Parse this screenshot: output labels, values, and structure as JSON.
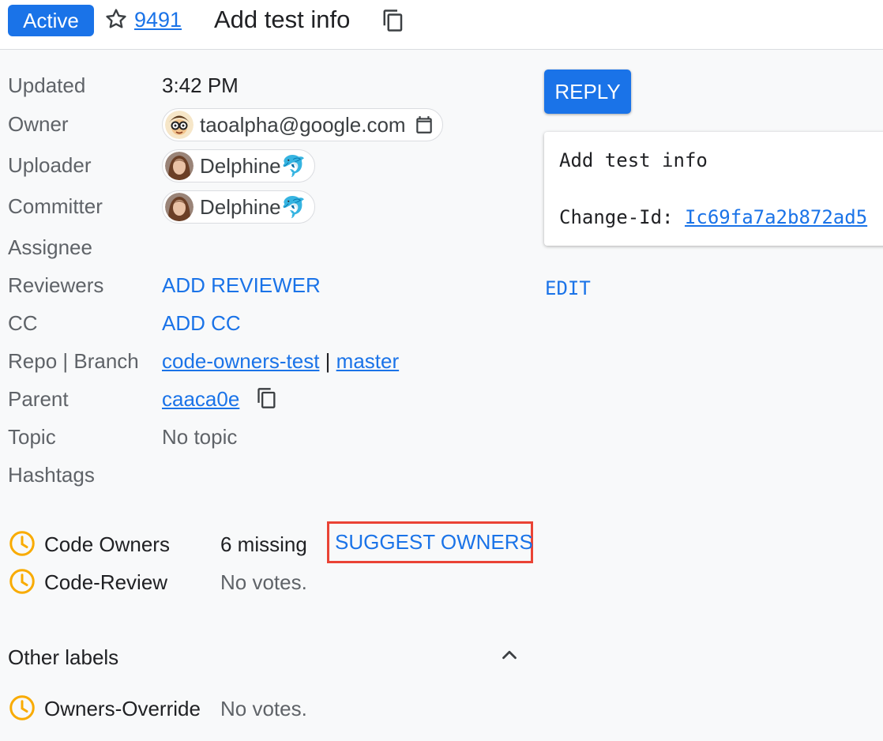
{
  "header": {
    "status": "Active",
    "change_number": "9491",
    "subject": "Add test info"
  },
  "metadata": {
    "updated": {
      "label": "Updated",
      "value": "3:42 PM"
    },
    "owner": {
      "label": "Owner",
      "value": "taoalpha@google.com"
    },
    "uploader": {
      "label": "Uploader",
      "value": "Delphine🐬"
    },
    "committer": {
      "label": "Committer",
      "value": "Delphine🐬"
    },
    "assignee": {
      "label": "Assignee"
    },
    "reviewers": {
      "label": "Reviewers",
      "action": "ADD REVIEWER"
    },
    "cc": {
      "label": "CC",
      "action": "ADD CC"
    },
    "repo_branch": {
      "label": "Repo | Branch",
      "repo": "code-owners-test",
      "separator": "|",
      "branch": "master"
    },
    "parent": {
      "label": "Parent",
      "value": "caaca0e"
    },
    "topic": {
      "label": "Topic",
      "value": "No topic"
    },
    "hashtags": {
      "label": "Hashtags"
    }
  },
  "submit_requirements": [
    {
      "label": "Code Owners",
      "status": "6 missing",
      "action": "SUGGEST OWNERS"
    },
    {
      "label": "Code-Review",
      "status": "No votes."
    }
  ],
  "other_labels": {
    "title": "Other labels",
    "items": [
      {
        "label": "Owners-Override",
        "status": "No votes."
      }
    ]
  },
  "right_panel": {
    "reply": "REPLY",
    "commit_message": {
      "line1": "Add test info",
      "change_id_label": "Change-Id: ",
      "change_id": "Ic69fa7a2b872ad5"
    },
    "edit": "EDIT"
  },
  "colors": {
    "accent": "#1a73e8",
    "pending_clock": "#f9ab00",
    "highlight_border": "#ea4335"
  }
}
